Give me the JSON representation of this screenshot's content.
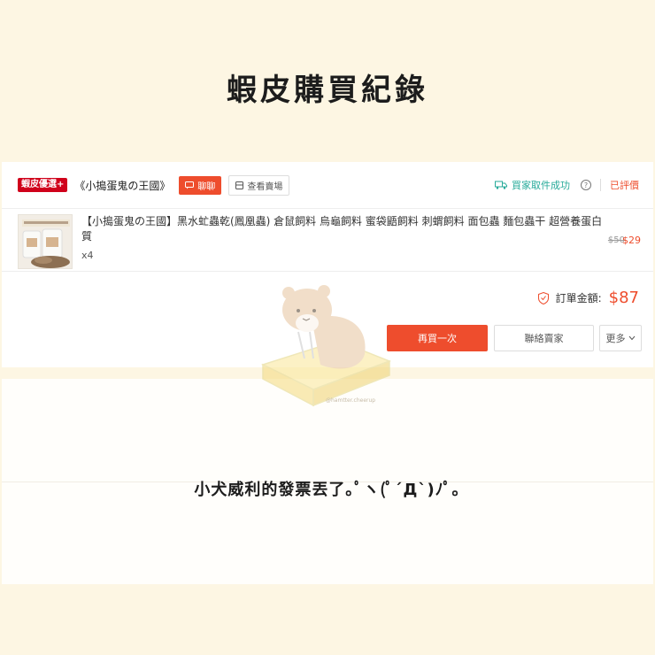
{
  "page": {
    "title": "蝦皮購買紀錄",
    "note": "小犬威利的發票丟了｡ﾟヽ(ﾟ´Д`)ﾉﾟ｡"
  },
  "order": {
    "mall_badge": "蝦皮優選+",
    "shop_name": "《小搗蛋鬼の王國》",
    "chat_label": "聊聊",
    "view_shop_label": "查看賣場",
    "shipping_status": "買家取件成功",
    "rating_status": "已評價",
    "item": {
      "title": "【小搗蛋鬼の王國】黑水虻蟲乾(鳳凰蟲) 倉鼠飼料 烏龜飼料 蜜袋鼯飼料 刺蝟飼料 面包蟲 麵包蟲干 超營養蛋白質",
      "quantity": "x4",
      "original_price": "$50",
      "price": "$29"
    },
    "total_label": "訂單金額:",
    "total_value": "$87",
    "buttons": {
      "rebuy": "再買一次",
      "contact_seller": "聯絡賣家",
      "more": "更多"
    }
  },
  "watermark": "@hamtter.cheerup",
  "colors": {
    "accent": "#ee4d2d",
    "mall_red": "#d0011b",
    "shipping_green": "#26aa99",
    "background": "#fdf6e3"
  },
  "icons": [
    "chat-icon",
    "store-icon",
    "truck-icon",
    "help-icon",
    "shield-icon",
    "chevron-down-icon"
  ]
}
